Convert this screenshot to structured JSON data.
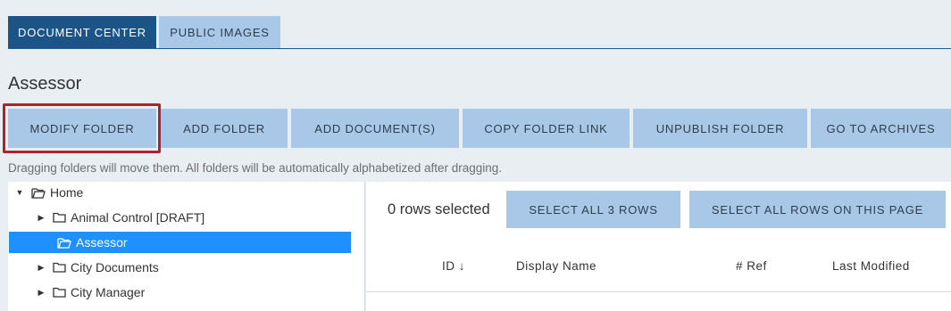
{
  "tabs": [
    {
      "label": "DOCUMENT CENTER",
      "active": true
    },
    {
      "label": "PUBLIC IMAGES",
      "active": false
    }
  ],
  "page_title": "Assessor",
  "toolbar": {
    "buttons": [
      {
        "label": "MODIFY FOLDER"
      },
      {
        "label": "ADD FOLDER"
      },
      {
        "label": "ADD DOCUMENT(S)"
      },
      {
        "label": "COPY FOLDER LINK"
      },
      {
        "label": "UNPUBLISH FOLDER"
      },
      {
        "label": "GO TO ARCHIVES"
      }
    ]
  },
  "hint": "Dragging folders will move them. All folders will be automatically alphabetized after dragging.",
  "tree": {
    "items": [
      {
        "label": "Home",
        "expanded": true
      },
      {
        "label": "Animal Control [DRAFT]"
      },
      {
        "label": "Assessor",
        "selected": true
      },
      {
        "label": "City Documents"
      },
      {
        "label": "City Manager"
      }
    ]
  },
  "grid": {
    "rows_selected": "0 rows selected",
    "select_all_label": "SELECT ALL 3 ROWS",
    "select_page_label": "SELECT ALL ROWS ON THIS PAGE",
    "columns": [
      {
        "label": "ID ↓"
      },
      {
        "label": "Display Name"
      },
      {
        "label": "# Ref"
      },
      {
        "label": "Last Modified"
      }
    ]
  },
  "colors": {
    "active_tab": "#1c5488",
    "button": "#a9c7e6",
    "selection": "#1e90ff",
    "highlight_border": "#b2202b"
  }
}
